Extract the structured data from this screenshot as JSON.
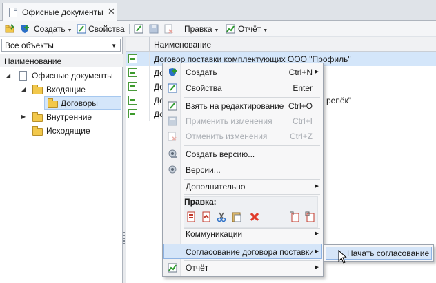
{
  "tab": {
    "title": "Офисные документы",
    "close": "✕"
  },
  "toolbar": {
    "create": "Создать",
    "properties": "Свойства",
    "edit": "Правка",
    "report": "Отчёт"
  },
  "left_panel": {
    "filter_value": "Все объекты",
    "column_header": "Наименование",
    "tree": [
      {
        "label": "Офисные документы"
      },
      {
        "label": "Входящие"
      },
      {
        "label": "Договоры"
      },
      {
        "label": "Внутренние"
      },
      {
        "label": "Исходящие"
      }
    ]
  },
  "grid": {
    "column_header": "Наименование",
    "rows": [
      {
        "text": "Договор поставки комплектующих ООО \"Профиль\""
      },
      {
        "text": "Дог"
      },
      {
        "text": "До"
      },
      {
        "text": "До",
        "suffix": "репёк\""
      },
      {
        "text": "До"
      }
    ]
  },
  "context_menu": {
    "items": [
      {
        "label": "Создать",
        "shortcut": "Ctrl+N"
      },
      {
        "label": "Свойства",
        "shortcut": "Enter"
      },
      {
        "label": "Взять на редактирование",
        "shortcut": "Ctrl+O"
      },
      {
        "label": "Применить изменения",
        "shortcut": "Ctrl+I"
      },
      {
        "label": "Отменить изменения",
        "shortcut": "Ctrl+Z"
      },
      {
        "label": "Создать версию..."
      },
      {
        "label": "Версии..."
      },
      {
        "label": "Дополнительно"
      },
      {
        "label": "Коммуникации"
      },
      {
        "label": "Согласование договора поставки"
      },
      {
        "label": "Отчёт"
      }
    ],
    "edit_group_label": "Правка:"
  },
  "submenu": {
    "start_approval": "Начать согласование"
  },
  "colors": {
    "selection": "#d4e6fa",
    "highlight": "#d5e5f8",
    "folder": "#f2c84b",
    "delete": "#e03a2a"
  }
}
